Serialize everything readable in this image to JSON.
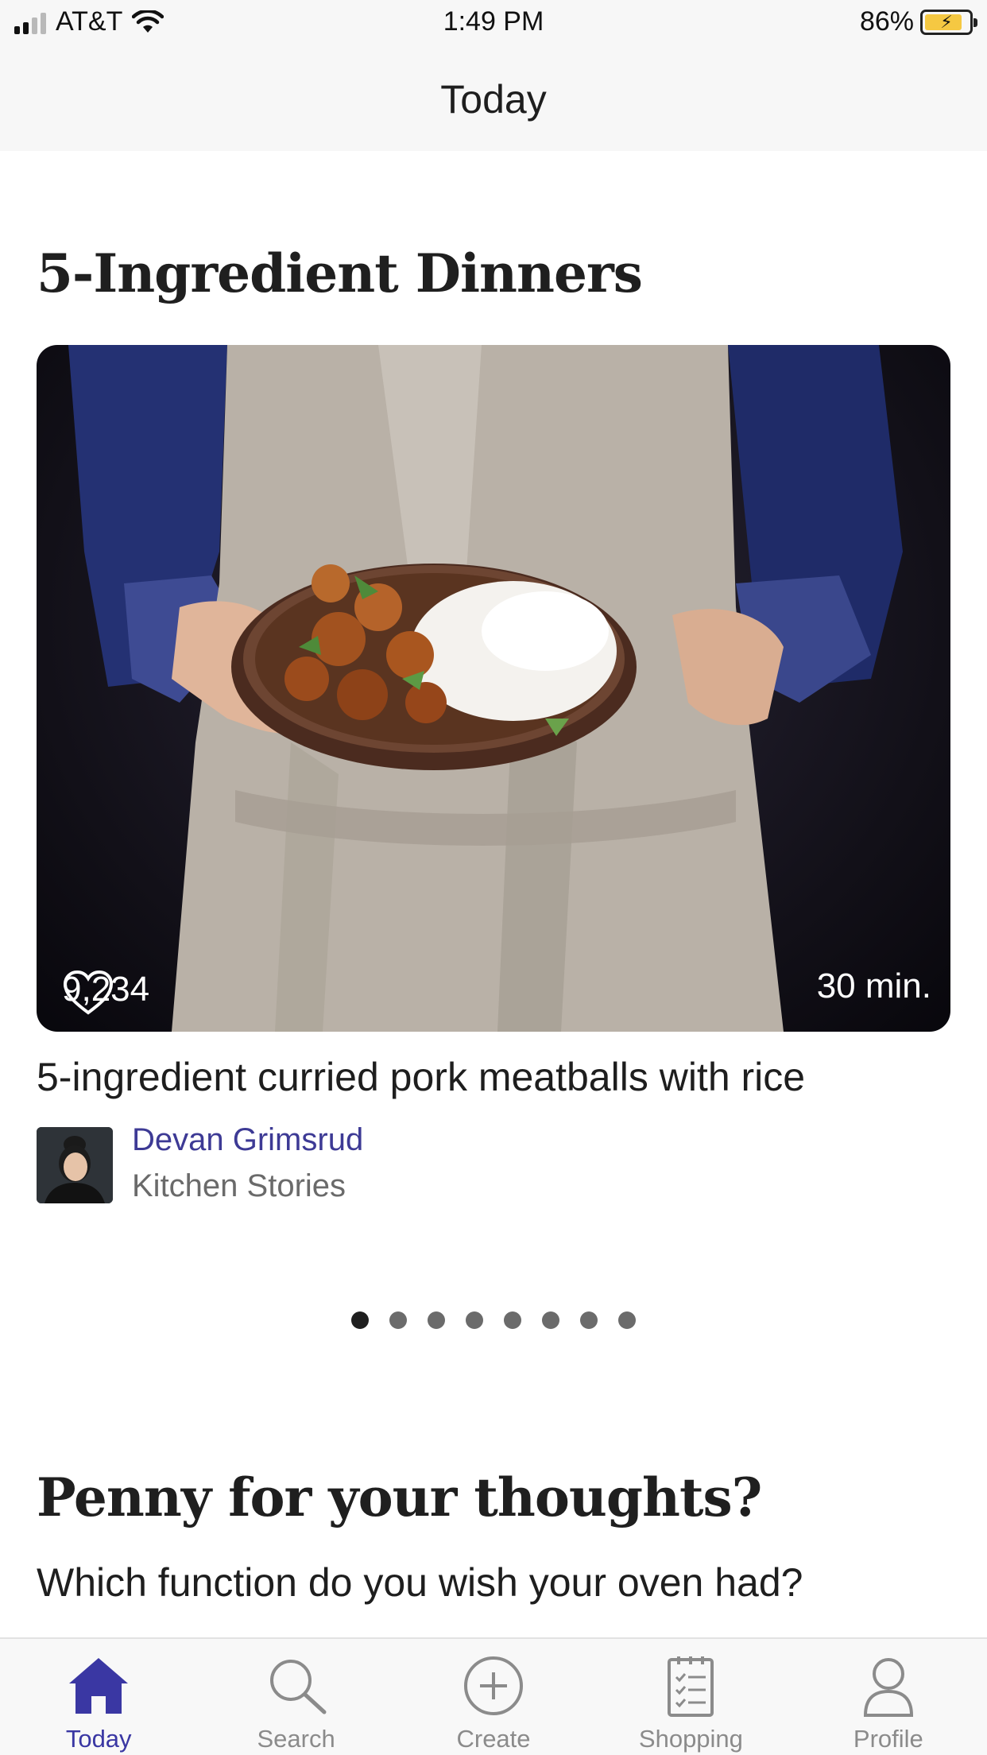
{
  "status_bar": {
    "carrier": "AT&T",
    "time": "1:49 PM",
    "battery": "86%"
  },
  "header": {
    "title": "Today"
  },
  "featured": {
    "section_title": "5-Ingredient Dinners",
    "likes": "9,234",
    "duration": "30 min.",
    "recipe_title": "5-ingredient curried pork meatballs with rice",
    "author": "Devan Grimsrud",
    "publisher": "Kitchen Stories",
    "carousel": {
      "total": 8,
      "active_index": 0
    }
  },
  "poll": {
    "title": "Penny for your thoughts?",
    "question": "Which function do you wish your oven had?"
  },
  "tabbar": {
    "items": [
      {
        "label": "Today",
        "icon": "home-icon",
        "active": true
      },
      {
        "label": "Search",
        "icon": "search-icon",
        "active": false
      },
      {
        "label": "Create",
        "icon": "plus-circle-icon",
        "active": false
      },
      {
        "label": "Shopping",
        "icon": "shopping-list-icon",
        "active": false
      },
      {
        "label": "Profile",
        "icon": "profile-icon",
        "active": false
      }
    ]
  },
  "colors": {
    "accent": "#3a37a3",
    "author_link": "#3d3a95",
    "inactive": "#8b8b8b"
  }
}
